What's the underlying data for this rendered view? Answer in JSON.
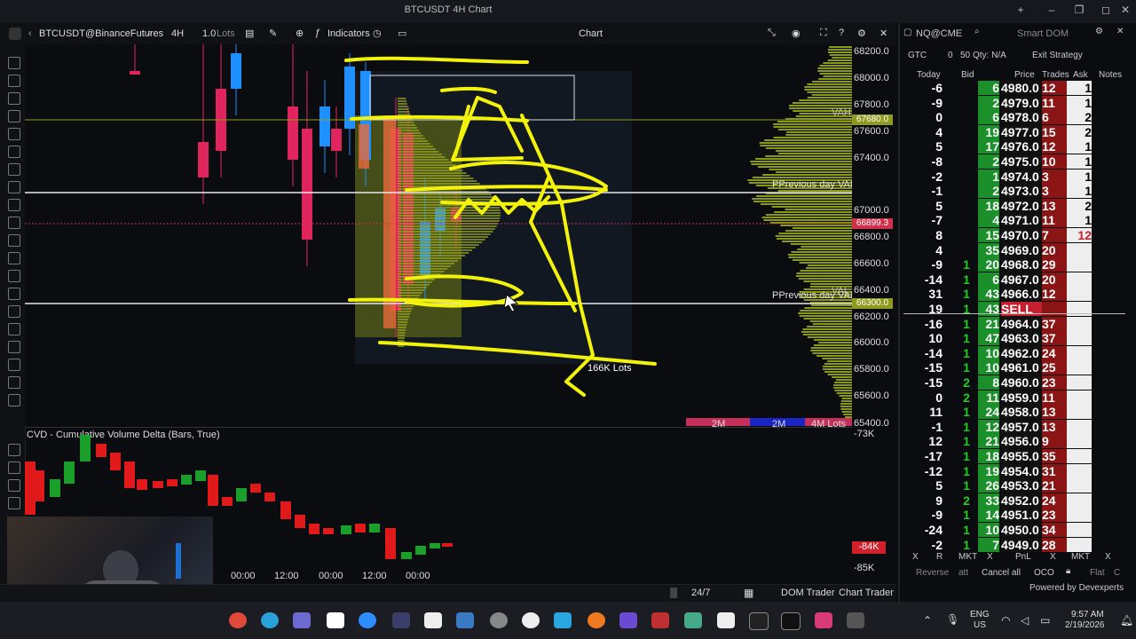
{
  "window_title": "BTCUSDT 4H Chart",
  "toolbar": {
    "symbol": "BTCUSDT@BinanceFutures",
    "interval": "4H",
    "lots": "1.0",
    "lots_unit": "Lots",
    "indicators": "Indicators",
    "tab_title": "Chart"
  },
  "price_axis": [
    "68200.0",
    "68000.0",
    "67800.0",
    "67600.0",
    "67400.0",
    "67000.0",
    "66800.0",
    "66600.0",
    "66400.0",
    "66200.0",
    "66000.0",
    "65800.0",
    "65600.0",
    "65400.0"
  ],
  "price_tags": {
    "vah_level": "67680.0",
    "current": "66899.3",
    "line_2": "66300.0",
    "vah": "VAH",
    "val": "VAL"
  },
  "annotations": {
    "prev_day_vah": "PPrevious day VAH",
    "prev_day_val": "PPrevious day VAL",
    "lots_label": "166K Lots"
  },
  "volume_bar": [
    "2M",
    "2M",
    "4M Lots"
  ],
  "cvd": {
    "title": "CVD - Cumulative Volume Delta (Bars, True)",
    "axis_top": "-73K",
    "axis_current": "-84K",
    "axis_bottom": "-85K",
    "time_labels": [
      "00:00",
      "12:00",
      "00:00",
      "12:00",
      "00:00"
    ]
  },
  "bottom_bar": {
    "session": "24/7",
    "dom_trader": "DOM Trader",
    "chart_trader": "Chart Trader"
  },
  "dom": {
    "symbol": "NQ@CME",
    "smart_dom": "Smart DOM",
    "tif": "GTC",
    "qty_prefix": "0",
    "qty": "50",
    "qty_label": "Qty: N/A",
    "strategy": "Exit Strategy",
    "headers": [
      "Today",
      "Bid",
      "Price",
      "Trades",
      "Ask",
      "Notes"
    ],
    "rows": [
      {
        "today": "-6",
        "bid": "6",
        "price": "4980.0",
        "trades": "12",
        "ask": "1"
      },
      {
        "today": "-9",
        "bid": "2",
        "price": "4979.0",
        "trades": "11",
        "ask": "1"
      },
      {
        "today": "0",
        "bid": "6",
        "price": "4978.0",
        "trades": "6",
        "ask": "2"
      },
      {
        "today": "4",
        "bid": "19",
        "price": "4977.0",
        "trades": "15",
        "ask": "2"
      },
      {
        "today": "5",
        "bid": "17",
        "price": "4976.0",
        "trades": "12",
        "ask": "1"
      },
      {
        "today": "-8",
        "bid": "2",
        "price": "4975.0",
        "trades": "10",
        "ask": "1"
      },
      {
        "today": "-2",
        "bid": "1",
        "price": "4974.0",
        "trades": "3",
        "ask": "1"
      },
      {
        "today": "-1",
        "bid": "2",
        "price": "4973.0",
        "trades": "3",
        "ask": "1"
      },
      {
        "today": "5",
        "bid": "18",
        "price": "4972.0",
        "trades": "13",
        "ask": "2"
      },
      {
        "today": "-7",
        "bid": "4",
        "price": "4971.0",
        "trades": "11",
        "ask": "1"
      },
      {
        "today": "8",
        "bid": "15",
        "price": "4970.0",
        "trades": "7",
        "ask": "12"
      },
      {
        "today": "4",
        "bid": "35",
        "price": "4969.0",
        "trades": "20",
        "ask": ""
      },
      {
        "today": "-9",
        "bid": "1",
        "bid2": "20",
        "price": "4968.0",
        "trades": "29",
        "ask": ""
      },
      {
        "today": "-14",
        "bid": "1",
        "bid2": "6",
        "price": "4967.0",
        "trades": "20",
        "ask": ""
      },
      {
        "today": "31",
        "bid": "1",
        "bid2": "43",
        "price": "4966.0",
        "trades": "12",
        "ask": ""
      },
      {
        "today": "19",
        "bid": "1",
        "bid2": "43",
        "price": "SELL STP",
        "trades": "",
        "ask": ""
      },
      {
        "today": "-16",
        "bid": "1",
        "bid2": "21",
        "price": "4964.0",
        "trades": "37",
        "ask": ""
      },
      {
        "today": "10",
        "bid": "1",
        "bid2": "47",
        "price": "4963.0",
        "trades": "37",
        "ask": ""
      },
      {
        "today": "-14",
        "bid": "1",
        "bid2": "10",
        "price": "4962.0",
        "trades": "24",
        "ask": ""
      },
      {
        "today": "-15",
        "bid": "1",
        "bid2": "10",
        "price": "4961.0",
        "trades": "25",
        "ask": ""
      },
      {
        "today": "-15",
        "bid": "2",
        "bid2": "8",
        "price": "4960.0",
        "trades": "23",
        "ask": ""
      },
      {
        "today": "0",
        "bid": "2",
        "bid2": "11",
        "price": "4959.0",
        "trades": "11",
        "ask": ""
      },
      {
        "today": "11",
        "bid": "1",
        "bid2": "24",
        "price": "4958.0",
        "trades": "13",
        "ask": ""
      },
      {
        "today": "-1",
        "bid": "1",
        "bid2": "12",
        "price": "4957.0",
        "trades": "13",
        "ask": ""
      },
      {
        "today": "12",
        "bid": "1",
        "bid2": "21",
        "price": "4956.0",
        "trades": "9",
        "ask": ""
      },
      {
        "today": "-17",
        "bid": "1",
        "bid2": "18",
        "price": "4955.0",
        "trades": "35",
        "ask": ""
      },
      {
        "today": "-12",
        "bid": "1",
        "bid2": "19",
        "price": "4954.0",
        "trades": "31",
        "ask": ""
      },
      {
        "today": "5",
        "bid": "1",
        "bid2": "26",
        "price": "4953.0",
        "trades": "21",
        "ask": ""
      },
      {
        "today": "9",
        "bid": "2",
        "bid2": "33",
        "price": "4952.0",
        "trades": "24",
        "ask": ""
      },
      {
        "today": "-9",
        "bid": "1",
        "bid2": "14",
        "price": "4951.0",
        "trades": "23",
        "ask": ""
      },
      {
        "today": "-24",
        "bid": "1",
        "bid2": "10",
        "price": "4950.0",
        "trades": "34",
        "ask": ""
      },
      {
        "today": "-2",
        "bid": "1",
        "bid2": "7",
        "price": "4949.0",
        "trades": "28",
        "ask": ""
      }
    ],
    "footer_buttons": [
      "X",
      "R",
      "MKT",
      "X",
      "PnL",
      "X",
      "MKT",
      "X"
    ],
    "actions": [
      "Reverse",
      "att",
      "Cancel all",
      "OCO",
      "Flat",
      "C"
    ],
    "powered_by": "Powered by Devexperts"
  },
  "taskbar": {
    "lang": "ENG",
    "region": "US",
    "time": "9:57 AM",
    "date": "2/19/2026"
  },
  "colors": {
    "yellow": "#f2f20a",
    "bull": "#1e90ff",
    "bear": "#e0245e",
    "green": "#1a8f2a",
    "red": "#8b1515"
  }
}
